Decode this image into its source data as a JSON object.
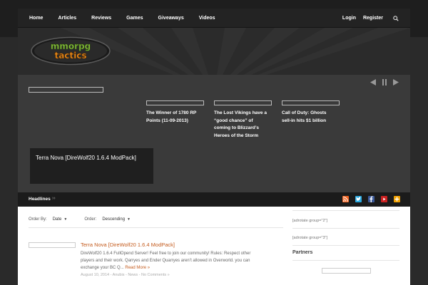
{
  "nav": {
    "items": [
      {
        "label": "Home"
      },
      {
        "label": "Articles"
      },
      {
        "label": "Reviews"
      },
      {
        "label": "Games"
      },
      {
        "label": "Giveaways"
      },
      {
        "label": "Videos"
      }
    ],
    "login": "Login",
    "register": "Register",
    "search_icon": "search-icon"
  },
  "logo": {
    "line1": "mmorpg",
    "line2": "tactics"
  },
  "slider": {
    "cards": [
      {
        "title": "The Winner of 1780 RP Points (11-09-2013)"
      },
      {
        "title": "The Lost Vikings have a “good chance” of coming to Blizzard’s Heroes of the Storm"
      },
      {
        "title": "Call of Duty: Ghosts sell-in hits $1 billion"
      }
    ],
    "feature_title": "Terra Nova [DireWolf20 1.6.4 ModPack]",
    "controls": [
      "prev-icon",
      "pause-icon",
      "next-icon"
    ]
  },
  "headlines": {
    "label": "Headlines",
    "arrow": "››",
    "social": [
      "rss-icon",
      "twitter-icon",
      "facebook-icon",
      "youtube-icon",
      "plus-icon"
    ]
  },
  "sort": {
    "order_by_label": "Order By:",
    "order_by_value": "Date",
    "order_label": "Order:",
    "order_value": "Descending"
  },
  "post": {
    "title": "Terra Nova [DireWolf20 1.6.4 ModPack]",
    "excerpt": "DireWolf20 1.6.4 FullOpend Server! Feel free to join our community! Rules: Respect other players and their work. Qarryes and Ender Quarryes aren’t allowed in Overworld. you can exchange your BC Q...",
    "read_more": "Read More »",
    "meta": "August 10, 2014 - Anubis - News - No Comments »"
  },
  "sidebar": {
    "ad1": "[adrotate group=\"2\"]",
    "ad2": "[adrotate group=\"3\"]",
    "partners": "Partners"
  },
  "colors": {
    "accent_orange": "#c45b1d",
    "logo_green": "#8bc53f",
    "logo_orange": "#f7941d"
  }
}
